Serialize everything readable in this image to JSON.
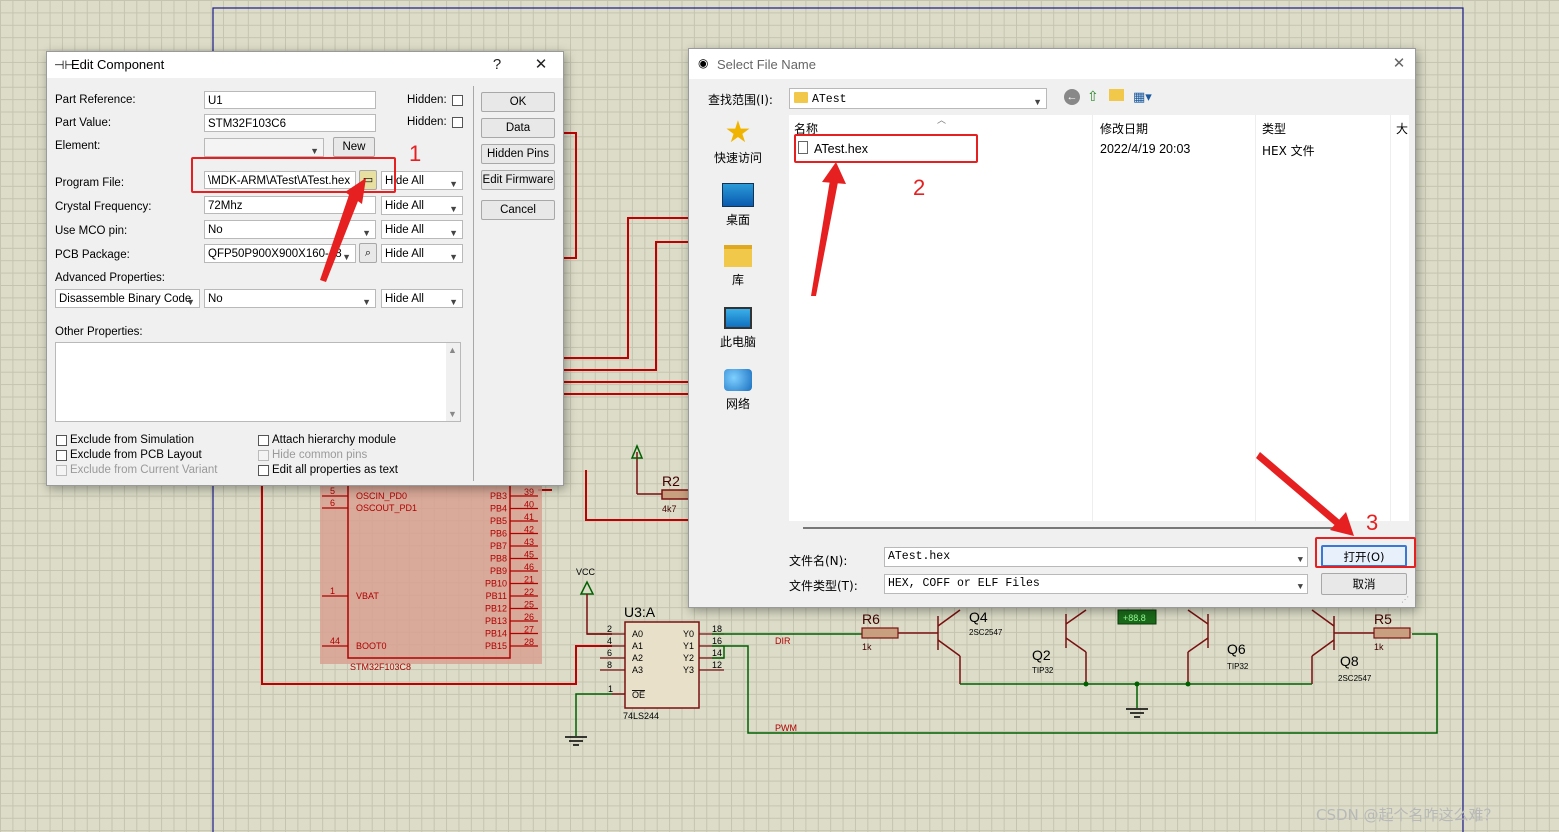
{
  "edit_component": {
    "title": "Edit Component",
    "help_button": "?",
    "close_button": "✕",
    "part_reference_label": "Part Reference:",
    "part_reference_value": "U1",
    "part_value_label": "Part Value:",
    "part_value_value": "STM32F103C6",
    "hidden_label": "Hidden:",
    "element_label": "Element:",
    "new_button": "New",
    "program_file_label": "Program File:",
    "program_file_value": "\\MDK-ARM\\ATest\\ATest.hex",
    "crystal_label": "Crystal Frequency:",
    "crystal_value": "72Mhz",
    "mco_label": "Use MCO pin:",
    "mco_value": "No",
    "pcb_label": "PCB Package:",
    "pcb_value": "QFP50P900X900X160-48",
    "hide_all": "Hide All",
    "advanced_label": "Advanced Properties:",
    "advanced_property": "Disassemble Binary Code",
    "advanced_value": "No",
    "other_label": "Other Properties:",
    "buttons": {
      "ok": "OK",
      "data": "Data",
      "hidden_pins": "Hidden Pins",
      "edit_firmware": "Edit Firmware",
      "cancel": "Cancel"
    },
    "checks": {
      "exclude_sim": "Exclude from Simulation",
      "exclude_pcb": "Exclude from PCB Layout",
      "exclude_variant": "Exclude from Current Variant",
      "attach_hier": "Attach hierarchy module",
      "hide_common": "Hide common pins",
      "edit_all": "Edit all properties as text"
    }
  },
  "file_dialog": {
    "title": "Select File Name",
    "lookin_label": "查找范围(I):",
    "lookin_value": "ATest",
    "nav": [
      "快速访问",
      "桌面",
      "库",
      "此电脑",
      "网络"
    ],
    "columns": {
      "name": "名称",
      "date": "修改日期",
      "type": "类型",
      "size": "大"
    },
    "file": {
      "name": "ATest.hex",
      "date": "2022/4/19 20:03",
      "type": "HEX 文件"
    },
    "filename_label": "文件名(N):",
    "filename_value": "ATest.hex",
    "filetype_label": "文件类型(T):",
    "filetype_value": "HEX, COFF or ELF Files",
    "open_button": "打开(O)",
    "cancel_button": "取消"
  },
  "annotations": {
    "step1": "1",
    "step2": "2",
    "step3": "3"
  },
  "schematic": {
    "mcu": {
      "left_pins": [
        {
          "num": "5",
          "name": "OSCIN_PD0"
        },
        {
          "num": "6",
          "name": "OSCOUT_PD1"
        },
        {
          "num": "1",
          "name": "VBAT"
        },
        {
          "num": "44",
          "name": "BOOT0"
        }
      ],
      "right_pins": [
        {
          "name": "PB3",
          "num": "39"
        },
        {
          "name": "PB4",
          "num": "40"
        },
        {
          "name": "PB5",
          "num": "41"
        },
        {
          "name": "PB6",
          "num": "42"
        },
        {
          "name": "PB7",
          "num": "43"
        },
        {
          "name": "PB8",
          "num": "45"
        },
        {
          "name": "PB9",
          "num": "46"
        },
        {
          "name": "PB10",
          "num": "21"
        },
        {
          "name": "PB11",
          "num": "22"
        },
        {
          "name": "PB12",
          "num": "25"
        },
        {
          "name": "PB13",
          "num": "26"
        },
        {
          "name": "PB14",
          "num": "27"
        },
        {
          "name": "PB15",
          "num": "28"
        }
      ],
      "part": "STM32F103C8"
    },
    "buffer": {
      "ref": "U3:A",
      "part": "74LS244",
      "inputs": [
        {
          "num": "2",
          "name": "A0"
        },
        {
          "num": "4",
          "name": "A1"
        },
        {
          "num": "6",
          "name": "A2"
        },
        {
          "num": "8",
          "name": "A3"
        }
      ],
      "outputs": [
        {
          "name": "Y0",
          "num": "18"
        },
        {
          "name": "Y1",
          "num": "16"
        },
        {
          "name": "Y2",
          "num": "14"
        },
        {
          "name": "Y3",
          "num": "12"
        }
      ],
      "oe_num": "1",
      "oe_name": "OE"
    },
    "vcc": "VCC",
    "r2": {
      "ref": "R2",
      "value": "4k7"
    },
    "r6": {
      "ref": "R6",
      "value": "1k"
    },
    "r5": {
      "ref": "R5",
      "value": "1k"
    },
    "q4": {
      "ref": "Q4",
      "part": "2SC2547"
    },
    "q2": {
      "ref": "Q2",
      "part": "TIP32"
    },
    "q6": {
      "ref": "Q6",
      "part": "TIP32"
    },
    "q8": {
      "ref": "Q8",
      "part": "2SC2547"
    },
    "dir": "DIR",
    "pwm": "PWM",
    "meter": "+88.8"
  },
  "watermark": "CSDN @起个名咋这么难？"
}
